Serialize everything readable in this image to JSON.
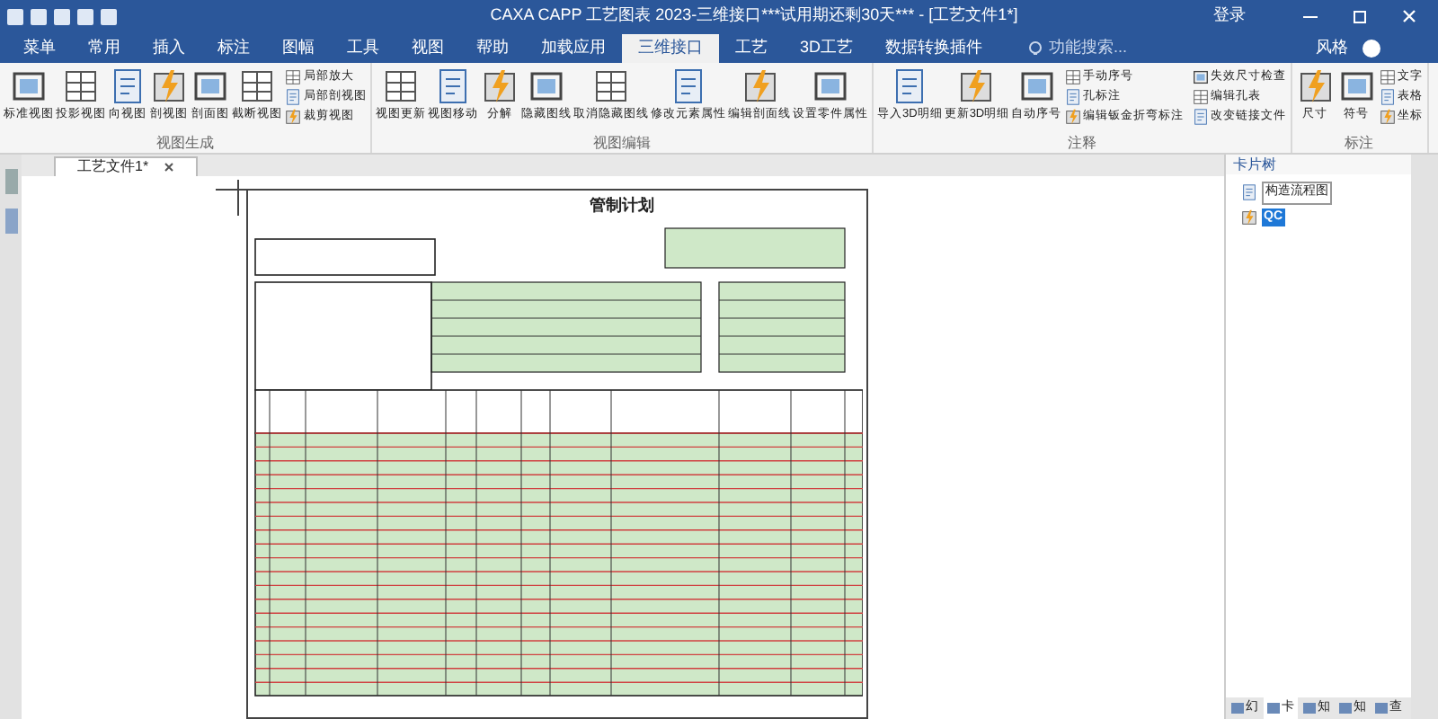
{
  "window": {
    "title": "CAXA CAPP 工艺图表 2023-三维接口***试用期还剩30天*** - [工艺文件1*]",
    "login": "登录",
    "style_menu": "风格"
  },
  "ribbon_tabs": [
    {
      "label": "菜单",
      "selected": false
    },
    {
      "label": "常用",
      "selected": false
    },
    {
      "label": "插入",
      "selected": false
    },
    {
      "label": "标注",
      "selected": false
    },
    {
      "label": "图幅",
      "selected": false
    },
    {
      "label": "工具",
      "selected": false
    },
    {
      "label": "视图",
      "selected": false
    },
    {
      "label": "帮助",
      "selected": false
    },
    {
      "label": "加载应用",
      "selected": false
    },
    {
      "label": "三维接口",
      "selected": true
    },
    {
      "label": "工艺",
      "selected": false
    },
    {
      "label": "3D工艺",
      "selected": false
    },
    {
      "label": "数据转换插件",
      "selected": false
    }
  ],
  "search": {
    "placeholder": "功能搜索..."
  },
  "ribbon_groups": [
    {
      "title": "视图生成",
      "large": [
        "标准视图",
        "投影视图",
        "向视图",
        "剖视图",
        "剖面图",
        "截断视图"
      ],
      "small": [
        "局部放大",
        "局部剖视图",
        "裁剪视图"
      ]
    },
    {
      "title": "视图编辑",
      "large": [
        "视图更新",
        "视图移动",
        "分解",
        "隐藏图线",
        "取消隐藏图线",
        "修改元素属性",
        "编辑剖面线",
        "设置零件属性"
      ]
    },
    {
      "title": "注释",
      "large": [
        "导入3D明细",
        "更新3D明细",
        "自动序号"
      ],
      "small": [
        "手动序号",
        "孔标注",
        "编辑钣金折弯标注",
        "失效尺寸检查",
        "编辑孔表",
        "改变链接文件"
      ]
    },
    {
      "title": "标注",
      "large": [
        "尺寸",
        "符号"
      ],
      "small": [
        "文字",
        "表格",
        "坐标"
      ]
    }
  ],
  "document_tab": {
    "label": "工艺文件1*"
  },
  "sheet": {
    "title": "管制计划"
  },
  "card_tree": {
    "title": "卡片树",
    "items": [
      {
        "label": "构造流程图",
        "selected": false
      },
      {
        "label": "QC",
        "selected": true
      }
    ]
  },
  "panel_tabs": [
    {
      "label": "幻",
      "selected": false
    },
    {
      "label": "卡",
      "selected": true
    },
    {
      "label": "知",
      "selected": false
    },
    {
      "label": "知",
      "selected": false
    },
    {
      "label": "查",
      "selected": false
    }
  ]
}
